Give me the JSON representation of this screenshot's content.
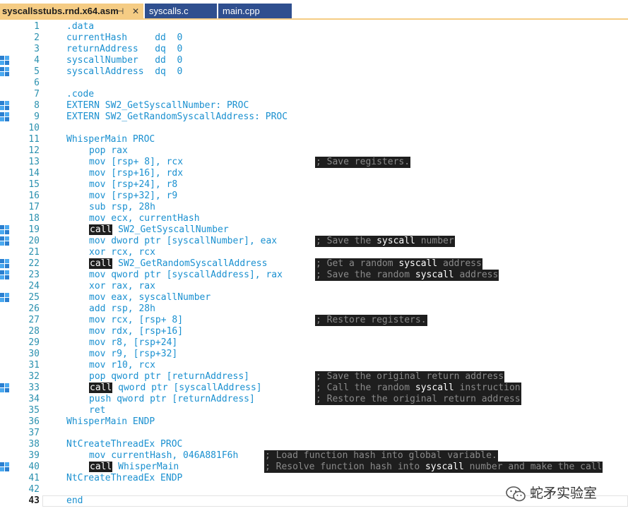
{
  "tabs": [
    {
      "label": "syscallsstubs.rnd.x64.asm",
      "active": true,
      "pin": "⊣",
      "close": "✕"
    },
    {
      "label": "syscalls.c",
      "active": false
    },
    {
      "label": "main.cpp",
      "active": false
    }
  ],
  "current_line": 43,
  "lines": [
    {
      "num": "1",
      "code": ".data",
      "indent": 0,
      "marker": false
    },
    {
      "num": "2",
      "code": "currentHash     dd  0",
      "indent": 0,
      "marker": false
    },
    {
      "num": "3",
      "code": "returnAddress   dq  0",
      "indent": 0,
      "marker": false
    },
    {
      "num": "4",
      "code": "syscallNumber   dd  0",
      "indent": 0,
      "marker": true
    },
    {
      "num": "5",
      "code": "syscallAddress  dq  0",
      "indent": 0,
      "marker": true
    },
    {
      "num": "6",
      "code": "",
      "indent": 0,
      "marker": false
    },
    {
      "num": "7",
      "code": ".code",
      "indent": 0,
      "marker": false
    },
    {
      "num": "8",
      "code": "EXTERN SW2_GetSyscallNumber: PROC",
      "indent": 0,
      "marker": true
    },
    {
      "num": "9",
      "code": "EXTERN SW2_GetRandomSyscallAddress: PROC",
      "indent": 0,
      "marker": true
    },
    {
      "num": "10",
      "code": "",
      "indent": 0,
      "marker": false
    },
    {
      "num": "11",
      "code": "WhisperMain PROC",
      "indent": 0,
      "marker": false
    },
    {
      "num": "12",
      "code": "pop rax",
      "indent": 1,
      "marker": false
    },
    {
      "num": "13",
      "code": "mov [rsp+ 8], rcx",
      "indent": 1,
      "marker": false,
      "comment": "; Save registers.",
      "comment_col": 446
    },
    {
      "num": "14",
      "code": "mov [rsp+16], rdx",
      "indent": 1,
      "marker": false
    },
    {
      "num": "15",
      "code": "mov [rsp+24], r8",
      "indent": 1,
      "marker": false
    },
    {
      "num": "16",
      "code": "mov [rsp+32], r9",
      "indent": 1,
      "marker": false
    },
    {
      "num": "17",
      "code": "sub rsp, 28h",
      "indent": 1,
      "marker": false
    },
    {
      "num": "18",
      "code": "mov ecx, currentHash",
      "indent": 1,
      "marker": false
    },
    {
      "num": "19",
      "kw": "call",
      "code": "SW2_GetSyscallNumber",
      "indent": 1,
      "marker": true
    },
    {
      "num": "20",
      "code": "mov dword ptr [syscallNumber], eax",
      "indent": 1,
      "marker": true,
      "comment": "; Save the ",
      "comment_hl": "syscall",
      "comment_tail": " number",
      "comment_col": 446
    },
    {
      "num": "21",
      "code": "xor rcx, rcx",
      "indent": 1,
      "marker": false
    },
    {
      "num": "22",
      "kw": "call",
      "code": "SW2_GetRandomSyscallAddress",
      "indent": 1,
      "marker": true,
      "comment": "; Get a random ",
      "comment_hl": "syscall",
      "comment_tail": " address",
      "comment_col": 446
    },
    {
      "num": "23",
      "code": "mov qword ptr [syscallAddress], rax",
      "indent": 1,
      "marker": true,
      "comment": "; Save the random ",
      "comment_hl": "syscall",
      "comment_tail": " address",
      "comment_col": 446
    },
    {
      "num": "24",
      "code": "xor rax, rax",
      "indent": 1,
      "marker": false
    },
    {
      "num": "25",
      "code": "mov eax, syscallNumber",
      "indent": 1,
      "marker": true
    },
    {
      "num": "26",
      "code": "add rsp, 28h",
      "indent": 1,
      "marker": false
    },
    {
      "num": "27",
      "code": "mov rcx, [rsp+ 8]",
      "indent": 1,
      "marker": false,
      "comment": "; Restore registers.",
      "comment_col": 446
    },
    {
      "num": "28",
      "code": "mov rdx, [rsp+16]",
      "indent": 1,
      "marker": false
    },
    {
      "num": "29",
      "code": "mov r8, [rsp+24]",
      "indent": 1,
      "marker": false
    },
    {
      "num": "30",
      "code": "mov r9, [rsp+32]",
      "indent": 1,
      "marker": false
    },
    {
      "num": "31",
      "code": "mov r10, rcx",
      "indent": 1,
      "marker": false
    },
    {
      "num": "32",
      "code": "pop qword ptr [returnAddress]",
      "indent": 1,
      "marker": false,
      "comment": "; Save the original return address",
      "comment_col": 446
    },
    {
      "num": "33",
      "kw": "call",
      "code": "qword ptr [syscallAddress]",
      "indent": 1,
      "marker": true,
      "comment": "; Call the random ",
      "comment_hl": "syscall",
      "comment_tail": " instruction",
      "comment_col": 446
    },
    {
      "num": "34",
      "code": "push qword ptr [returnAddress]",
      "indent": 1,
      "marker": false,
      "comment": "; Restore the original return address",
      "comment_col": 446
    },
    {
      "num": "35",
      "code": "ret",
      "indent": 1,
      "marker": false
    },
    {
      "num": "36",
      "code": "WhisperMain ENDP",
      "indent": 0,
      "marker": false
    },
    {
      "num": "37",
      "code": "",
      "indent": 0,
      "marker": false
    },
    {
      "num": "38",
      "code": "NtCreateThreadEx PROC",
      "indent": 0,
      "marker": false
    },
    {
      "num": "39",
      "code": "mov currentHash, 046A881F6h",
      "indent": 1,
      "marker": false,
      "comment": "; Load function hash into global variable.",
      "comment_col": 374
    },
    {
      "num": "40",
      "kw": "call",
      "code": "WhisperMain",
      "indent": 1,
      "marker": true,
      "comment": "; Resolve function hash into ",
      "comment_hl": "syscall",
      "comment_tail": " number and make the call",
      "comment_col": 374
    },
    {
      "num": "41",
      "code": "NtCreateThreadEx ENDP",
      "indent": 0,
      "marker": false
    },
    {
      "num": "42",
      "code": "",
      "indent": 0,
      "marker": false
    },
    {
      "num": "43",
      "code": "end",
      "indent": 0,
      "marker": false
    }
  ],
  "watermark": "蛇矛实验室",
  "colors": {
    "tab_active": "#f5cc84",
    "tab_inactive": "#2f4f8f",
    "code": "#1a90d0",
    "line_number": "#2b91af",
    "marker": "#2a7fd0"
  }
}
